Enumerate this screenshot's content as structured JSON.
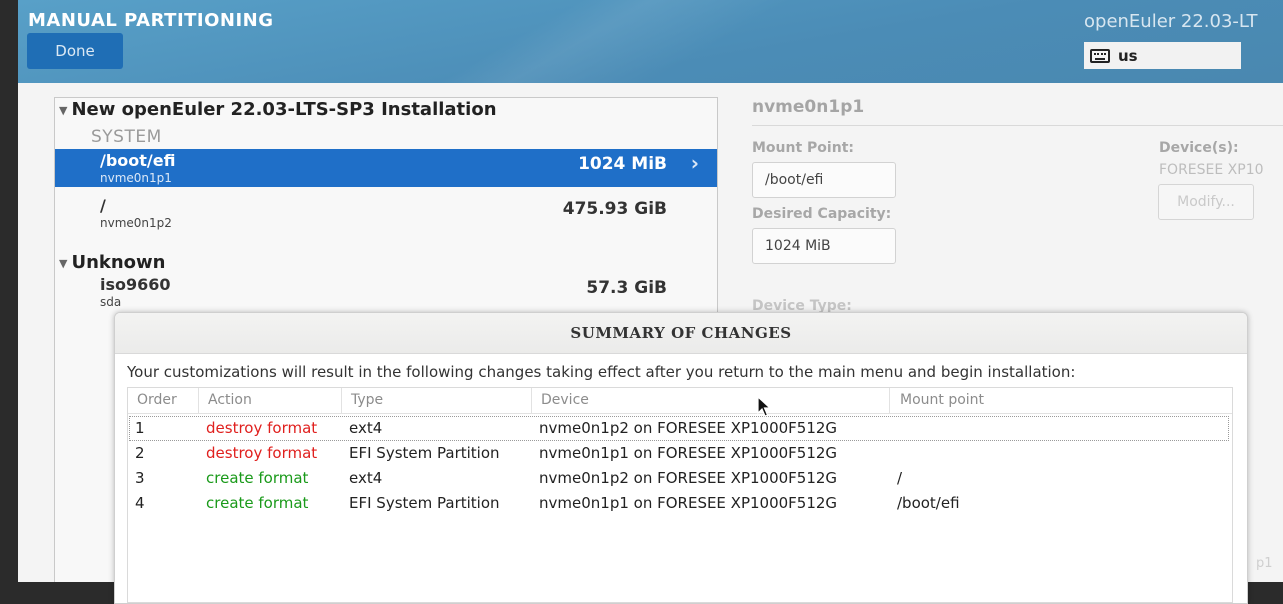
{
  "header": {
    "title": "MANUAL PARTITIONING",
    "done_label": "Done",
    "product": "openEuler 22.03-LT",
    "keyboard_layout": "us"
  },
  "partitions": {
    "group_install": "New openEuler 22.03-LTS-SP3 Installation",
    "system_label": "SYSTEM",
    "rows": [
      {
        "name": "/boot/efi",
        "device": "nvme0n1p1",
        "size": "1024 MiB"
      },
      {
        "name": "/",
        "device": "nvme0n1p2",
        "size": "475.93 GiB"
      }
    ],
    "group_unknown": "Unknown",
    "unknown_rows": [
      {
        "name": "iso9660",
        "device": "sda",
        "size": "57.3 GiB"
      }
    ]
  },
  "details": {
    "partition": "nvme0n1p1",
    "mount_point_label": "Mount Point:",
    "mount_point_value": "/boot/efi",
    "capacity_label": "Desired Capacity:",
    "capacity_value": "1024 MiB",
    "devices_label": "Device(s):",
    "device_name": "FORESEE XP10",
    "modify_label": "Modify...",
    "device_type_label": "Device Type:"
  },
  "dialog": {
    "title": "SUMMARY OF CHANGES",
    "description": "Your customizations will result in the following changes taking effect after you return to the main menu and begin installation:",
    "columns": [
      "Order",
      "Action",
      "Type",
      "Device",
      "Mount point"
    ],
    "rows": [
      {
        "order": "1",
        "action": "destroy format",
        "kind": "destroy",
        "type": "ext4",
        "device": "nvme0n1p2 on FORESEE XP1000F512G",
        "mount": ""
      },
      {
        "order": "2",
        "action": "destroy format",
        "kind": "destroy",
        "type": "EFI System Partition",
        "device": "nvme0n1p1 on FORESEE XP1000F512G",
        "mount": ""
      },
      {
        "order": "3",
        "action": "create format",
        "kind": "create",
        "type": "ext4",
        "device": "nvme0n1p2 on FORESEE XP1000F512G",
        "mount": "/"
      },
      {
        "order": "4",
        "action": "create format",
        "kind": "create",
        "type": "EFI System Partition",
        "device": "nvme0n1p1 on FORESEE XP1000F512G",
        "mount": "/boot/efi"
      }
    ]
  },
  "colors": {
    "header": "#4f94be",
    "selected": "#1f6fc8",
    "destroy": "#e0201e",
    "create": "#1a9a1a"
  },
  "background_ghost": "p1"
}
